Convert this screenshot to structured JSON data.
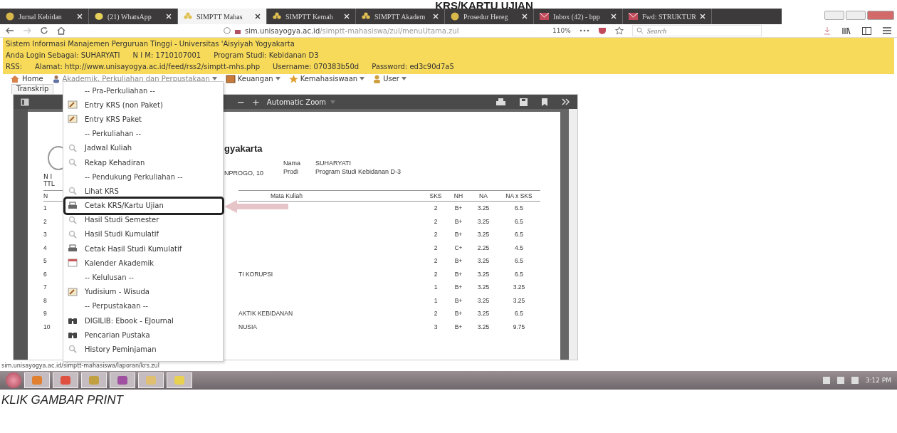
{
  "top_caption": "KRS/KARTU UJIAN",
  "tabs": [
    {
      "label": "Jurnal Kebidan",
      "kind": "site",
      "selected": false
    },
    {
      "label": "(21) WhatsApp",
      "kind": "chat",
      "selected": false
    },
    {
      "label": "SIMPTT Mahas",
      "kind": "simptt",
      "selected": true
    },
    {
      "label": "SIMPTT Kemah",
      "kind": "simptt",
      "selected": false
    },
    {
      "label": "SIMPTT Akadem",
      "kind": "simptt",
      "selected": false
    },
    {
      "label": "Prosedur Hereg",
      "kind": "site",
      "selected": false
    },
    {
      "label": "Inbox (42) - bpp",
      "kind": "mail",
      "selected": false
    },
    {
      "label": "Fwd: STRUKTUR",
      "kind": "mail",
      "selected": false
    }
  ],
  "address_bar": {
    "url_host": "sim.unisayogya.ac.id",
    "url_path": "/simptt-mahasiswa/zul/menuUtama.zul",
    "zoom": "110%",
    "search_placeholder": "Search"
  },
  "header": {
    "title": "Sistem Informasi Manajemen Perguruan Tinggi - Universitas 'Aisyiyah Yogyakarta",
    "login": "Anda Login Sebagai: SUHARYATI",
    "nim": "N I M: 1710107001",
    "program": "Program Studi: Kebidanan D3",
    "rss_label": "RSS:",
    "rss_address": "Alamat: http://www.unisayogya.ac.id/feed/rss2/simptt-mhs.php",
    "username": "Username: 070383b50d",
    "password": "Password: ed3c90d7a5"
  },
  "menu_bar": [
    {
      "label": "Home",
      "kind": "home",
      "dropdown": false,
      "open": false
    },
    {
      "label": "Akademik, Perkuliahan dan Perpustakaan",
      "kind": "academic",
      "dropdown": true,
      "open": true
    },
    {
      "label": "Keuangan",
      "kind": "finance",
      "dropdown": true,
      "open": false
    },
    {
      "label": "Kemahasiswaan",
      "kind": "student",
      "dropdown": true,
      "open": false
    },
    {
      "label": "User",
      "kind": "user",
      "dropdown": true,
      "open": false
    }
  ],
  "page_tab": "Transkrip",
  "dropdown": [
    {
      "label": "-- Pra-Perkuliahan --",
      "kind": "header"
    },
    {
      "label": "Entry KRS (non Paket)",
      "kind": "entry",
      "highlighted": false
    },
    {
      "label": "Entry KRS Paket",
      "kind": "entry",
      "highlighted": false
    },
    {
      "label": "-- Perkuliahan --",
      "kind": "header"
    },
    {
      "label": "Jadwal Kuliah",
      "kind": "view",
      "highlighted": false
    },
    {
      "label": "Rekap Kehadiran",
      "kind": "view",
      "highlighted": false
    },
    {
      "label": "-- Pendukung Perkuliahan --",
      "kind": "header"
    },
    {
      "label": "Lihat KRS",
      "kind": "view",
      "highlighted": false
    },
    {
      "label": "Cetak KRS/Kartu Ujian",
      "kind": "print",
      "highlighted": true
    },
    {
      "label": "Hasil Studi Semester",
      "kind": "view",
      "highlighted": false
    },
    {
      "label": "Hasil Studi Kumulatif",
      "kind": "view",
      "highlighted": false
    },
    {
      "label": "Cetak Hasil Studi Kumulatif",
      "kind": "print",
      "highlighted": false
    },
    {
      "label": "Kalender Akademik",
      "kind": "calendar",
      "highlighted": false
    },
    {
      "label": "-- Kelulusan --",
      "kind": "header"
    },
    {
      "label": "Yudisium - Wisuda",
      "kind": "entry",
      "highlighted": false
    },
    {
      "label": "-- Perpustakaan --",
      "kind": "header"
    },
    {
      "label": "DIGILIB: Ebook - EJournal",
      "kind": "library",
      "highlighted": false
    },
    {
      "label": "Pencarian Pustaka",
      "kind": "library",
      "highlighted": false
    },
    {
      "label": "History Peminjaman",
      "kind": "view",
      "highlighted": false
    }
  ],
  "pdf_viewer": {
    "zoom_out": "−",
    "zoom_in": "+",
    "zoom_select": "Automatic Zoom"
  },
  "document": {
    "heading": "gyakarta",
    "left_labels": [
      "N I",
      "TTL"
    ],
    "birth": "NPROGO, 10",
    "fields": [
      {
        "label": "Nama",
        "value": "SUHARYATI"
      },
      {
        "label": "Prodi",
        "value": "Program Studi Kebidanan D-3"
      }
    ],
    "columns": [
      "N",
      "Mata Kuliah",
      "SKS",
      "NH",
      "NA",
      "NA x SKS"
    ],
    "rows": [
      {
        "no": "1",
        "course": "",
        "sks": "2",
        "nh": "B+",
        "na": "3.25",
        "na_sks": "6.5"
      },
      {
        "no": "2",
        "course": "",
        "sks": "2",
        "nh": "B+",
        "na": "3.25",
        "na_sks": "6.5"
      },
      {
        "no": "3",
        "course": "",
        "sks": "2",
        "nh": "B+",
        "na": "3.25",
        "na_sks": "6.5"
      },
      {
        "no": "4",
        "course": "",
        "sks": "2",
        "nh": "C+",
        "na": "2.25",
        "na_sks": "4.5"
      },
      {
        "no": "5",
        "course": "",
        "sks": "2",
        "nh": "B+",
        "na": "3.25",
        "na_sks": "6.5"
      },
      {
        "no": "6",
        "course": "TI KORUPSI",
        "sks": "2",
        "nh": "B+",
        "na": "3.25",
        "na_sks": "6.5"
      },
      {
        "no": "7",
        "course": "",
        "sks": "1",
        "nh": "B+",
        "na": "3.25",
        "na_sks": "3.25"
      },
      {
        "no": "8",
        "course": "",
        "sks": "1",
        "nh": "B+",
        "na": "3.25",
        "na_sks": "3.25"
      },
      {
        "no": "9",
        "course": "AKTIK KEBIDANAN",
        "sks": "2",
        "nh": "B+",
        "na": "3.25",
        "na_sks": "6.5"
      },
      {
        "no": "10",
        "course": "NUSIA",
        "sks": "3",
        "nh": "B+",
        "na": "3.25",
        "na_sks": "9.75"
      }
    ]
  },
  "status_url": "sim.unisayogya.ac.id/simptt-mahasiswa/laporan/krs.zul",
  "taskbar": {
    "apps": [
      {
        "kind": "media"
      },
      {
        "kind": "browser"
      },
      {
        "kind": "files"
      },
      {
        "kind": "notes"
      },
      {
        "kind": "folder"
      },
      {
        "kind": "sticky"
      }
    ],
    "time": "3:12 PM"
  },
  "bottom_caption": "KLIK GAMBAR PRINT"
}
